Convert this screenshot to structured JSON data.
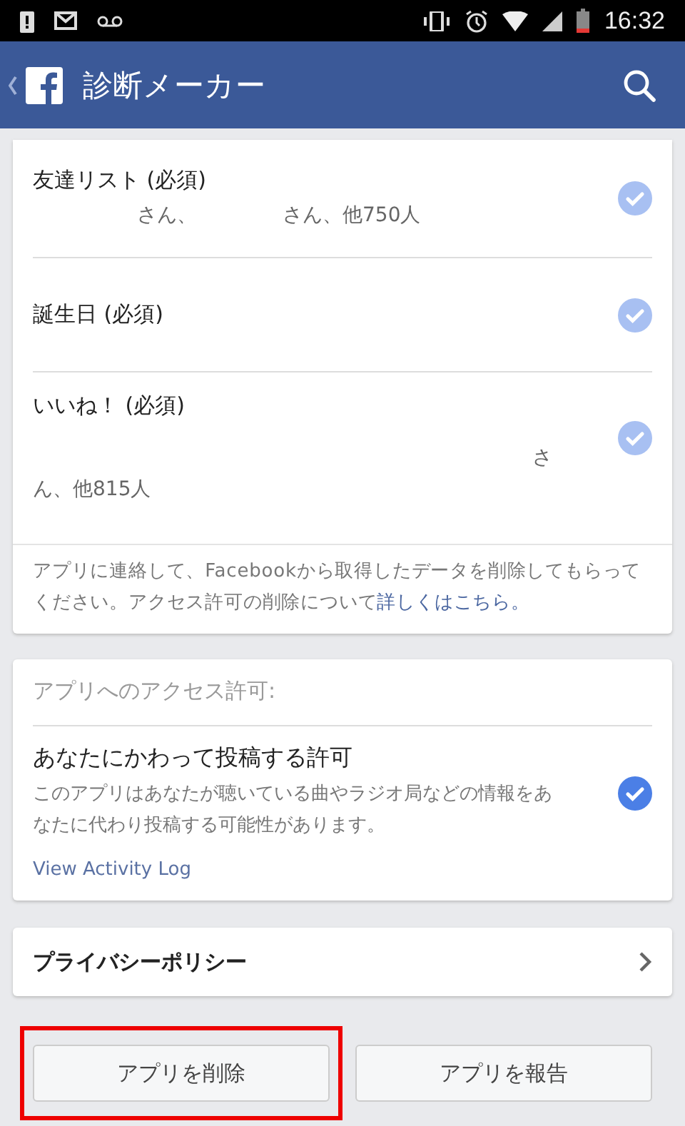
{
  "status_bar": {
    "time": "16:32"
  },
  "app_bar": {
    "title": "診断メーカー"
  },
  "required_items": [
    {
      "title": "友達リスト (必須)",
      "detail_parts": [
        "さん、",
        "さん、他750人"
      ],
      "checked": true,
      "disabled": true
    },
    {
      "title": "誕生日 (必須)",
      "checked": true,
      "disabled": true
    },
    {
      "title": "いいね！ (必須)",
      "detail_parts": [
        "さ",
        "ん、他815人"
      ],
      "checked": true,
      "disabled": true
    }
  ],
  "note": {
    "text": "アプリに連絡して、Facebookから取得したデータを削除してもらってください。アクセス許可の削除について",
    "link": "詳しくはこちら。"
  },
  "permissions": {
    "heading": "アプリへのアクセス許可:",
    "items": [
      {
        "title": "あなたにかわって投稿する許可",
        "description": "このアプリはあなたが聴いている曲やラジオ局などの情報をあなたに代わり投稿する可能性があります。",
        "checked": true,
        "disabled": false
      }
    ],
    "link": "View Activity Log"
  },
  "privacy_policy": {
    "label": "プライバシーポリシー"
  },
  "buttons": [
    {
      "label": "アプリを削除",
      "highlighted": true
    },
    {
      "label": "アプリを報告",
      "highlighted": false
    }
  ]
}
